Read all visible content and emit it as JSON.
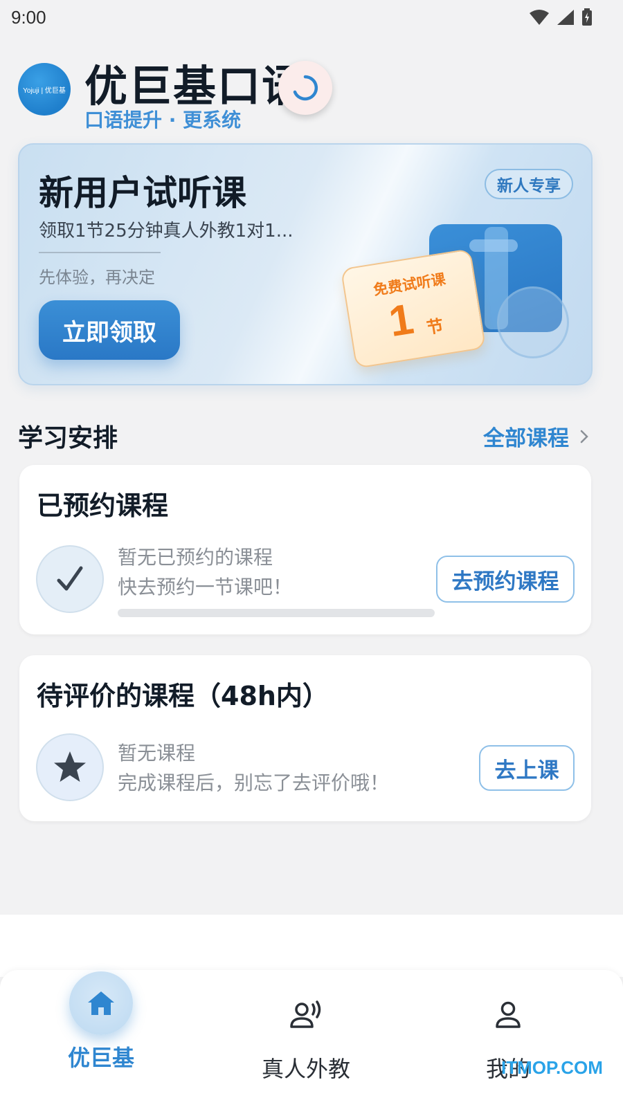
{
  "status_bar": {
    "time": "9:00"
  },
  "header": {
    "logo_text": "Yojuji | 优巨基",
    "app_title": "优巨基口语",
    "subtitle": "口语提升 · 更系统"
  },
  "trial_card": {
    "title": "新用户试听课",
    "description": "领取1节25分钟真人外教1对1...",
    "note": "先体验，再决定",
    "claim_button": "立即领取",
    "badge": "新人专享",
    "voucher_label": "免费试听课",
    "voucher_count": "1",
    "voucher_unit": "节"
  },
  "schedule": {
    "title": "学习安排",
    "all_courses_label": "全部课程"
  },
  "booked_card": {
    "title": "已预约课程",
    "empty_line1": "暂无已预约的课程",
    "empty_line2": "快去预约一节课吧！",
    "button": "去预约课程",
    "progress": 0
  },
  "review_card": {
    "title": "待评价的课程（48h内）",
    "empty_line1": "暂无课程",
    "empty_line2": "完成课程后，别忘了去评价哦！",
    "button": "去上课"
  },
  "tab_bar": {
    "tabs": [
      {
        "label": "优巨基",
        "icon": "home-icon",
        "active": true
      },
      {
        "label": "真人外教",
        "icon": "teacher-voice-icon",
        "active": false
      },
      {
        "label": "我的",
        "icon": "person-icon",
        "active": false
      }
    ]
  },
  "watermark": "ITMOP.COM",
  "colors": {
    "accent": "#2f86d0",
    "voucher": "#f07b1a",
    "background": "#f2f2f3"
  }
}
